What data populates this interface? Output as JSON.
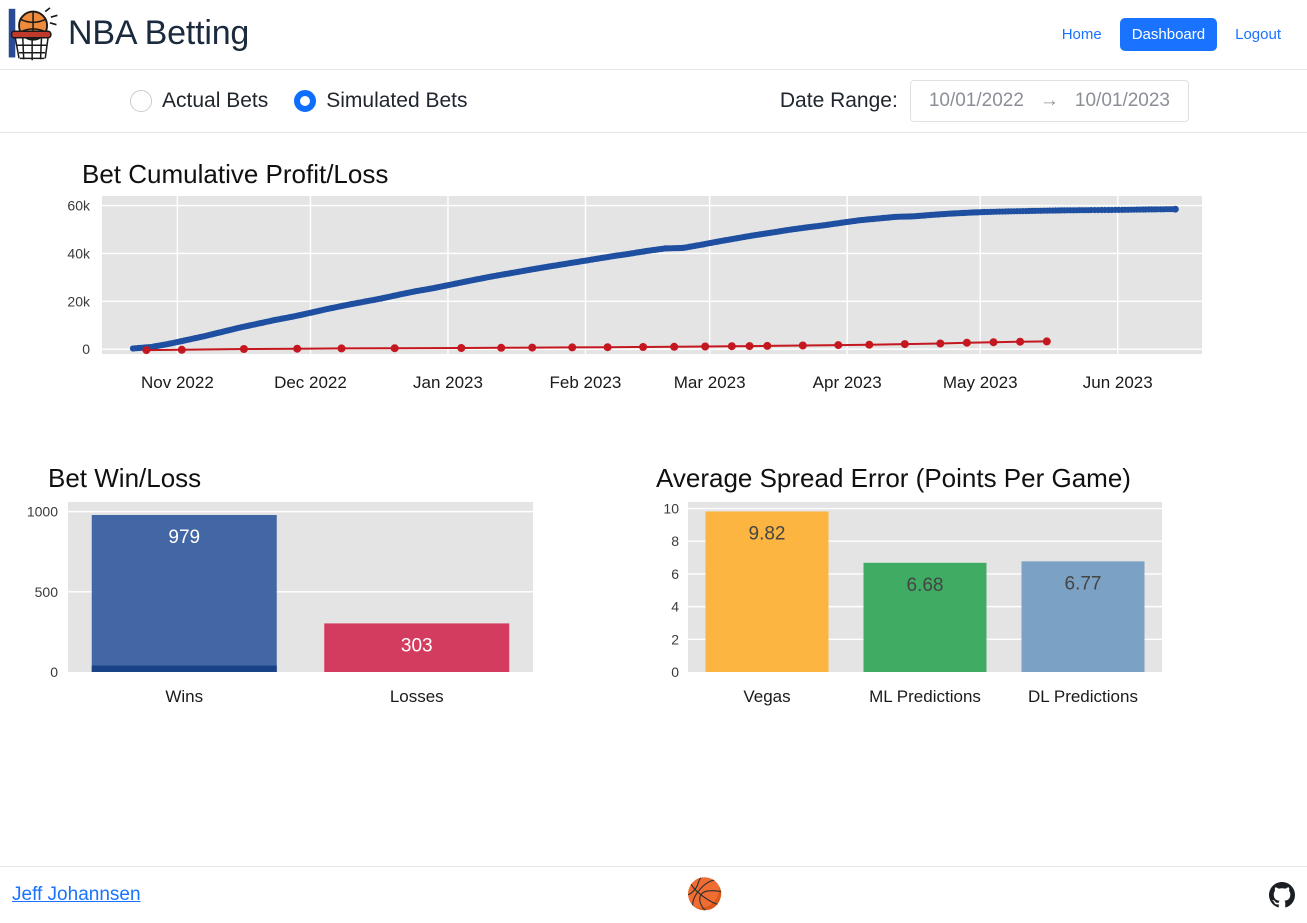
{
  "header": {
    "logo_icon": "basketball-hoop-icon",
    "title": "NBA Betting",
    "nav": [
      {
        "label": "Home",
        "active": false
      },
      {
        "label": "Dashboard",
        "active": true
      },
      {
        "label": "Logout",
        "active": false
      }
    ],
    "accent_color": "#1a73ff"
  },
  "controls": {
    "bet_mode_options": [
      {
        "label": "Actual Bets",
        "selected": false
      },
      {
        "label": "Simulated Bets",
        "selected": true
      }
    ],
    "date_range_caption": "Date Range:",
    "date_start": "10/01/2022",
    "date_arrow": "→",
    "date_end": "10/01/2023"
  },
  "charts": {
    "cumulative": {
      "title": "Bet Cumulative Profit/Loss"
    },
    "winloss": {
      "title": "Bet Win/Loss"
    },
    "spread": {
      "title": "Average Spread Error (Points Per Game)"
    }
  },
  "footer": {
    "author_link": "Jeff Johannsen",
    "center_icon": "basketball-icon",
    "center_glyph": "🏀",
    "github_icon": "github-icon"
  },
  "chart_data": [
    {
      "id": "cumulative-profit-loss",
      "type": "line",
      "title": "Bet Cumulative Profit/Loss",
      "xlabel": "",
      "ylabel": "",
      "ylim": [
        -2000,
        64000
      ],
      "yticks": [
        0,
        20000,
        40000,
        60000
      ],
      "ytick_labels": [
        "0",
        "20k",
        "40k",
        "60k"
      ],
      "xtick_labels": [
        "Nov 2022",
        "Dec 2022",
        "Jan 2023",
        "Feb 2023",
        "Mar 2023",
        "Apr 2023",
        "May 2023",
        "Jun 2023"
      ],
      "xlim_months": [
        "2022-10-15",
        "2023-06-20"
      ],
      "grid": true,
      "legend": "none",
      "series": [
        {
          "name": "Simulated Bets",
          "color": "#1f4fa0",
          "marker": "circle",
          "x": [
            "2022-10-22",
            "2022-10-26",
            "2022-10-30",
            "2022-11-03",
            "2022-11-07",
            "2022-11-11",
            "2022-11-15",
            "2022-11-19",
            "2022-11-23",
            "2022-11-27",
            "2022-12-01",
            "2022-12-05",
            "2022-12-09",
            "2022-12-13",
            "2022-12-17",
            "2022-12-21",
            "2022-12-25",
            "2022-12-29",
            "2023-01-02",
            "2023-01-06",
            "2023-01-10",
            "2023-01-14",
            "2023-01-18",
            "2023-01-22",
            "2023-01-26",
            "2023-01-30",
            "2023-02-03",
            "2023-02-07",
            "2023-02-11",
            "2023-02-15",
            "2023-02-19",
            "2023-02-23",
            "2023-02-27",
            "2023-03-03",
            "2023-03-07",
            "2023-03-11",
            "2023-03-15",
            "2023-03-19",
            "2023-03-23",
            "2023-03-27",
            "2023-03-31",
            "2023-04-04",
            "2023-04-08",
            "2023-04-12",
            "2023-04-16",
            "2023-04-20",
            "2023-04-24",
            "2023-04-28",
            "2023-05-02",
            "2023-05-08",
            "2023-05-14",
            "2023-05-20",
            "2023-05-26",
            "2023-06-02",
            "2023-06-08",
            "2023-06-14"
          ],
          "y": [
            300,
            900,
            2200,
            3800,
            5400,
            7200,
            9000,
            10600,
            12200,
            13600,
            15200,
            16900,
            18400,
            19800,
            21200,
            22800,
            24300,
            25600,
            27100,
            28600,
            30100,
            31400,
            32700,
            34000,
            35200,
            36400,
            37600,
            38800,
            39900,
            41100,
            42100,
            42300,
            43600,
            45000,
            46300,
            47600,
            48700,
            49900,
            50900,
            51800,
            52900,
            53900,
            54600,
            55300,
            55500,
            56100,
            56600,
            57000,
            57300,
            57600,
            57800,
            58000,
            58100,
            58200,
            58400,
            58500
          ]
        },
        {
          "name": "Actual Bets",
          "color": "#c4171f",
          "marker": "circle",
          "x": [
            "2022-10-25",
            "2022-11-02",
            "2022-11-16",
            "2022-11-28",
            "2022-12-08",
            "2022-12-20",
            "2023-01-04",
            "2023-01-13",
            "2023-01-20",
            "2023-01-29",
            "2023-02-06",
            "2023-02-14",
            "2023-02-21",
            "2023-02-28",
            "2023-03-06",
            "2023-03-10",
            "2023-03-14",
            "2023-03-22",
            "2023-03-30",
            "2023-04-06",
            "2023-04-14",
            "2023-04-22",
            "2023-04-28",
            "2023-05-04",
            "2023-05-10",
            "2023-05-16"
          ],
          "y": [
            -350,
            -250,
            80,
            200,
            320,
            420,
            520,
            600,
            680,
            760,
            860,
            930,
            1020,
            1120,
            1250,
            1320,
            1400,
            1560,
            1700,
            1900,
            2150,
            2400,
            2700,
            2950,
            3150,
            3250
          ]
        }
      ]
    },
    {
      "id": "bet-win-loss",
      "type": "bar",
      "title": "Bet Win/Loss",
      "categories": [
        "Wins",
        "Losses"
      ],
      "values": [
        979,
        303
      ],
      "value_labels": [
        "979",
        "303"
      ],
      "colors": [
        "#4366a5",
        "#d33c5e"
      ],
      "ylim": [
        0,
        1060
      ],
      "yticks": [
        0,
        500,
        1000
      ],
      "ytick_labels": [
        "0",
        "500",
        "1000"
      ],
      "grid": true,
      "legend": "none",
      "annotations": [
        {
          "name": "wins-baseline-band",
          "category": "Wins",
          "color": "#1a4287",
          "from": 0,
          "to": 40
        }
      ]
    },
    {
      "id": "average-spread-error",
      "type": "bar",
      "title": "Average Spread Error (Points Per Game)",
      "categories": [
        "Vegas",
        "ML Predictions",
        "DL Predictions"
      ],
      "values": [
        9.82,
        6.68,
        6.77
      ],
      "value_labels": [
        "9.82",
        "6.68",
        "6.77"
      ],
      "colors": [
        "#fbb540",
        "#40ab62",
        "#7ba2c4"
      ],
      "ylim": [
        0,
        10.4
      ],
      "yticks": [
        0,
        2,
        4,
        6,
        8,
        10
      ],
      "ytick_labels": [
        "0",
        "2",
        "4",
        "6",
        "8",
        "10"
      ],
      "ylabel": "",
      "xlabel": "",
      "grid": true,
      "legend": "none"
    }
  ]
}
